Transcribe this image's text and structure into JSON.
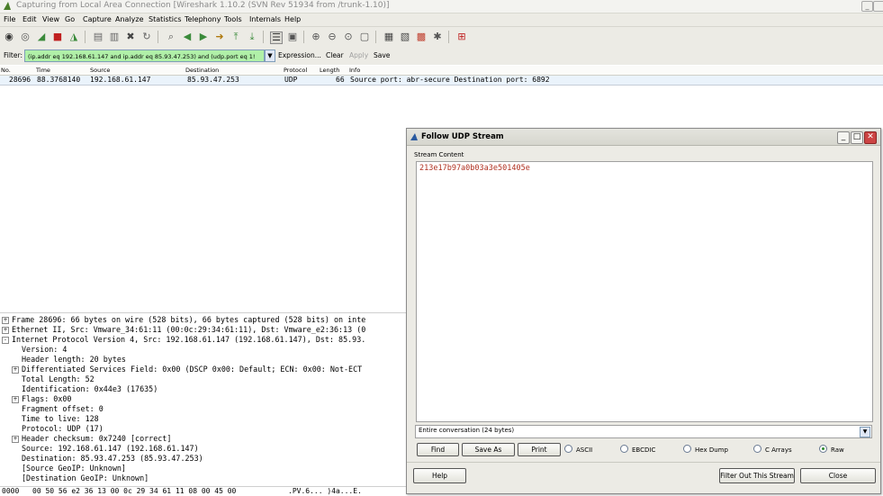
{
  "window": {
    "title": "Capturing from Local Area Connection    [Wireshark 1.10.2  (SVN Rev 51934 from /trunk-1.10)]",
    "min_label": "_"
  },
  "menu": [
    "File",
    "Edit",
    "View",
    "Go",
    "Capture",
    "Analyze",
    "Statistics",
    "Telephony",
    "Tools",
    "Internals",
    "Help"
  ],
  "filter": {
    "label": "Filter:",
    "value": "(ip.addr eq 192.168.61.147 and ip.addr eq 85.93.47.253) and (udp.port eq 1!",
    "expression": "Expression...",
    "clear": "Clear",
    "apply": "Apply",
    "save": "Save"
  },
  "packet_list": {
    "columns": [
      "No.",
      "Time",
      "Source",
      "Destination",
      "Protocol",
      "Length",
      "Info"
    ],
    "row": {
      "no": "28696",
      "time": "88.3768140",
      "source": "192.168.61.147",
      "destination": "85.93.47.253",
      "protocol": "UDP",
      "length": "66",
      "info": "Source port: abr-secure  Destination port: 6892"
    }
  },
  "details": [
    {
      "text": "Frame 28696: 66 bytes on wire (528 bits), 66 bytes captured (528 bits) on inte",
      "indent": 0,
      "exp": "+"
    },
    {
      "text": "Ethernet II, Src: Vmware_34:61:11 (00:0c:29:34:61:11), Dst: Vmware_e2:36:13 (0",
      "indent": 0,
      "exp": "+"
    },
    {
      "text": "Internet Protocol Version 4, Src: 192.168.61.147 (192.168.61.147), Dst: 85.93.",
      "indent": 0,
      "exp": "-"
    },
    {
      "text": "Version: 4",
      "indent": 2,
      "exp": ""
    },
    {
      "text": "Header length: 20 bytes",
      "indent": 2,
      "exp": ""
    },
    {
      "text": "Differentiated Services Field: 0x00 (DSCP 0x00: Default; ECN: 0x00: Not-ECT",
      "indent": 2,
      "exp": "+"
    },
    {
      "text": "Total Length: 52",
      "indent": 2,
      "exp": ""
    },
    {
      "text": "Identification: 0x44e3 (17635)",
      "indent": 2,
      "exp": ""
    },
    {
      "text": "Flags: 0x00",
      "indent": 2,
      "exp": "+"
    },
    {
      "text": "Fragment offset: 0",
      "indent": 2,
      "exp": ""
    },
    {
      "text": "Time to live: 128",
      "indent": 2,
      "exp": ""
    },
    {
      "text": "Protocol: UDP (17)",
      "indent": 2,
      "exp": ""
    },
    {
      "text": "Header checksum: 0x7240 [correct]",
      "indent": 2,
      "exp": "+"
    },
    {
      "text": "Source: 192.168.61.147 (192.168.61.147)",
      "indent": 2,
      "exp": ""
    },
    {
      "text": "Destination: 85.93.47.253 (85.93.47.253)",
      "indent": 2,
      "exp": ""
    },
    {
      "text": "[Source GeoIP: Unknown]",
      "indent": 2,
      "exp": ""
    },
    {
      "text": "[Destination GeoIP: Unknown]",
      "indent": 2,
      "exp": ""
    }
  ],
  "hex": {
    "offset": "0000",
    "bytes": "00 50 56 e2 36 13 00 0c  29 34 61 11 08 00 45 00",
    "ascii": ".PV.6... )4a...E."
  },
  "dialog": {
    "title": "Follow UDP Stream",
    "stream_label": "Stream Content",
    "content": "213e17b97a0b03a3e501405e",
    "conversation": "Entire conversation (24 bytes)",
    "buttons": {
      "find": "Find",
      "save_as": "Save As",
      "print": "Print",
      "help": "Help",
      "filter_out": "Filter Out This Stream",
      "close": "Close"
    },
    "radios": [
      {
        "label": "ASCII",
        "selected": false
      },
      {
        "label": "EBCDIC",
        "selected": false
      },
      {
        "label": "Hex Dump",
        "selected": false
      },
      {
        "label": "C Arrays",
        "selected": false
      },
      {
        "label": "Raw",
        "selected": true
      }
    ]
  }
}
